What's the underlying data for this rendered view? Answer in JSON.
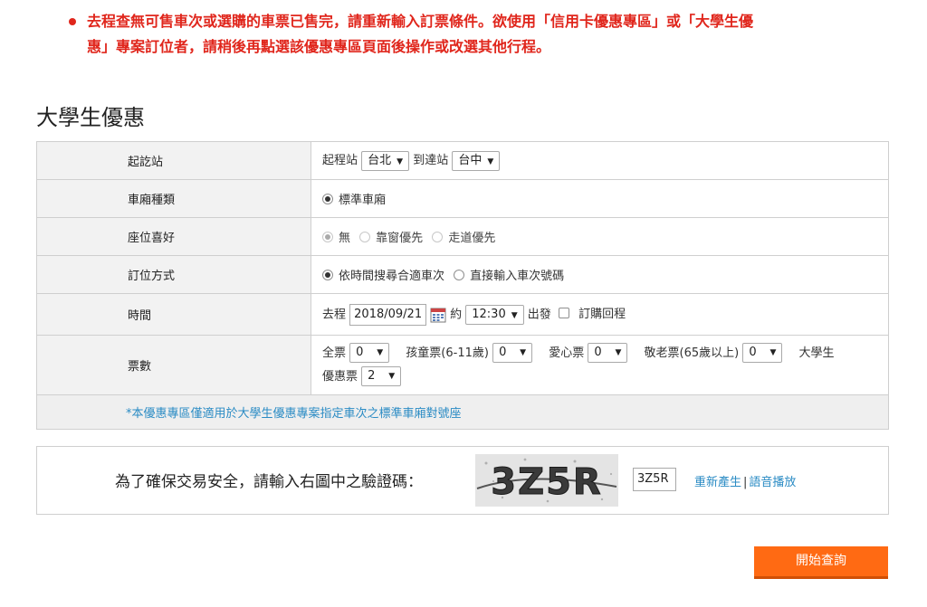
{
  "error": {
    "line1": "去程查無可售車次或選購的車票已售完，請重新輸入訂票條件。欲使用「信用卡優惠專區」或「大學生優",
    "line2": "惠」專案訂位者，請稍後再點選該優惠專區頁面後操作或改選其他行程。"
  },
  "page_title": "大學生優惠",
  "rows": {
    "station": {
      "label": "起訖站",
      "from_label": "起程站",
      "from_value": "台北",
      "to_label": "到達站",
      "to_value": "台中"
    },
    "car_type": {
      "label": "車廂種類",
      "option": "標準車廂"
    },
    "seat": {
      "label": "座位喜好",
      "options": [
        "無",
        "靠窗優先",
        "走道優先"
      ]
    },
    "booking": {
      "label": "訂位方式",
      "options": [
        "依時間搜尋合適車次",
        "直接輸入車次號碼"
      ]
    },
    "time": {
      "label": "時間",
      "outbound_label": "去程",
      "date": "2018/09/21",
      "approx_label": "約",
      "time_value": "12:30",
      "depart_label": "出發",
      "return_label": "訂購回程"
    },
    "tickets": {
      "label": "票數",
      "adult_label": "全票",
      "adult_value": "0",
      "child_label": "孩童票(6-11歲)",
      "child_value": "0",
      "disabled_label": "愛心票",
      "disabled_value": "0",
      "senior_label": "敬老票(65歲以上)",
      "senior_value": "0",
      "student_label_1": "大學生",
      "student_label_2": "優惠票",
      "student_value": "2"
    },
    "note": "*本優惠專區僅適用於大學生優惠專案指定車次之標準車廂對號座"
  },
  "captcha": {
    "label": "為了確保交易安全，請輸入右圖中之驗證碼：",
    "image_text": "3Z5R",
    "input_value": "3Z5R",
    "regenerate": "重新產生",
    "separator": "|",
    "audio": "語音播放"
  },
  "submit_label": "開始查詢",
  "colors": {
    "error": "#e0261c",
    "link": "#2a8bc4",
    "button": "#ff6a13"
  }
}
